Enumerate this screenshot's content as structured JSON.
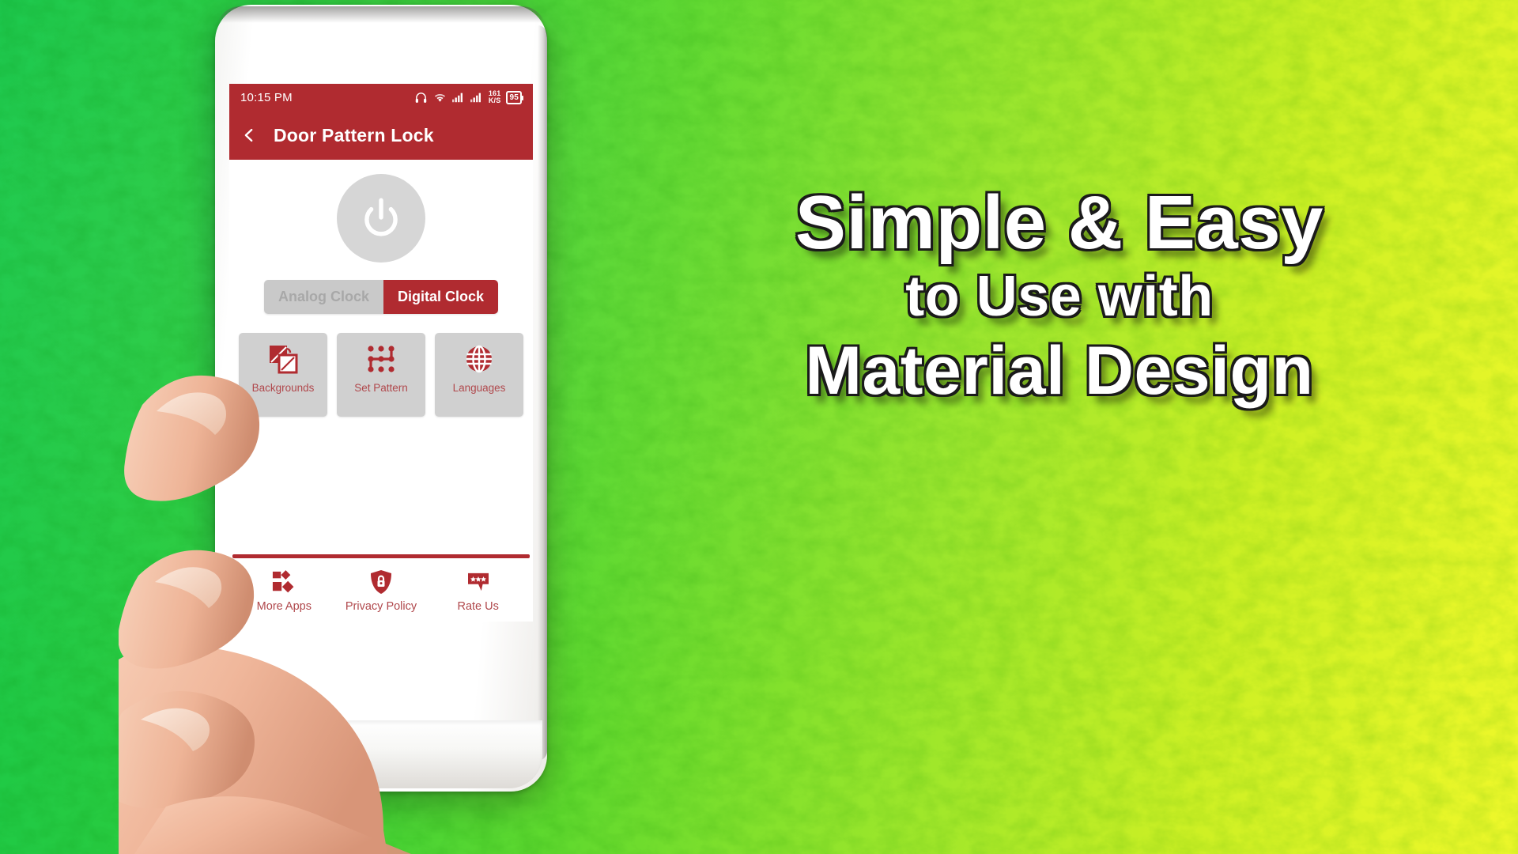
{
  "background": {
    "gradient_from": "#18c84a",
    "gradient_to": "#eff82a",
    "texture": "speckled-paint"
  },
  "brand": {
    "primary_red": "#b02b30",
    "muted_red": "#b0484c",
    "surface_gray": "#d0d0d0",
    "disabled_gray": "#a8a8a8"
  },
  "phone": {
    "body_color": "#ffffff"
  },
  "statusbar": {
    "time": "10:15 PM",
    "icons": [
      {
        "name": "headphones-icon"
      },
      {
        "name": "wifi-icon"
      },
      {
        "name": "signal-bars-icon"
      },
      {
        "name": "signal-bars-icon"
      }
    ],
    "net_speed_value": "161",
    "net_speed_unit": "K/S",
    "battery_percent": "95"
  },
  "appbar": {
    "back_icon": "chevron-left-icon",
    "title": "Door Pattern Lock"
  },
  "main": {
    "power_button": {
      "icon": "power-icon",
      "state": "off"
    },
    "clock_toggle": {
      "options": [
        {
          "label": "Analog Clock",
          "active": false
        },
        {
          "label": "Digital Clock",
          "active": true
        }
      ],
      "selected": "Digital Clock"
    },
    "cards": [
      {
        "label": "Backgrounds",
        "icon": "images-stack-icon"
      },
      {
        "label": "Set Pattern",
        "icon": "pattern-dots-icon"
      },
      {
        "label": "Languages",
        "icon": "globe-icon"
      }
    ]
  },
  "bottom_nav": {
    "items": [
      {
        "label": "More Apps",
        "icon": "apps-grid-icon"
      },
      {
        "label": "Privacy Policy",
        "icon": "shield-lock-icon"
      },
      {
        "label": "Rate Us",
        "icon": "review-stars-icon"
      }
    ]
  },
  "promo": {
    "line1": "Simple & Easy",
    "line2": "to Use with",
    "line3": "Material Design"
  }
}
